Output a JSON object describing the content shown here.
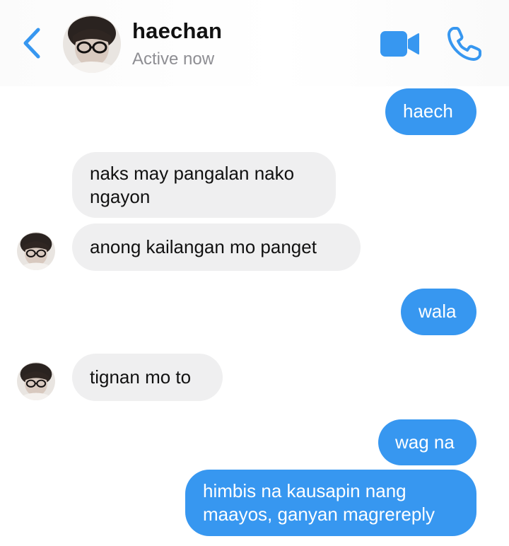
{
  "header": {
    "contact_name": "haechan",
    "status": "Active now",
    "back_icon": "chevron-left-icon",
    "video_icon": "video-camera-icon",
    "call_icon": "phone-icon",
    "accent_color": "#3797f0"
  },
  "messages": [
    {
      "sender": "me",
      "text": "haech"
    },
    {
      "sender": "haechan",
      "text": "naks may pangalan nako\nngayon"
    },
    {
      "sender": "haechan",
      "text": "anong kailangan mo panget"
    },
    {
      "sender": "me",
      "text": "wala"
    },
    {
      "sender": "haechan",
      "text": "tignan mo to"
    },
    {
      "sender": "me",
      "text": "wag na"
    },
    {
      "sender": "me",
      "text": "himbis na kausapin nang\nmaayos, ganyan magrereply"
    }
  ],
  "colors": {
    "outgoing_bubble": "#3797f0",
    "incoming_bubble": "#efeff0"
  }
}
